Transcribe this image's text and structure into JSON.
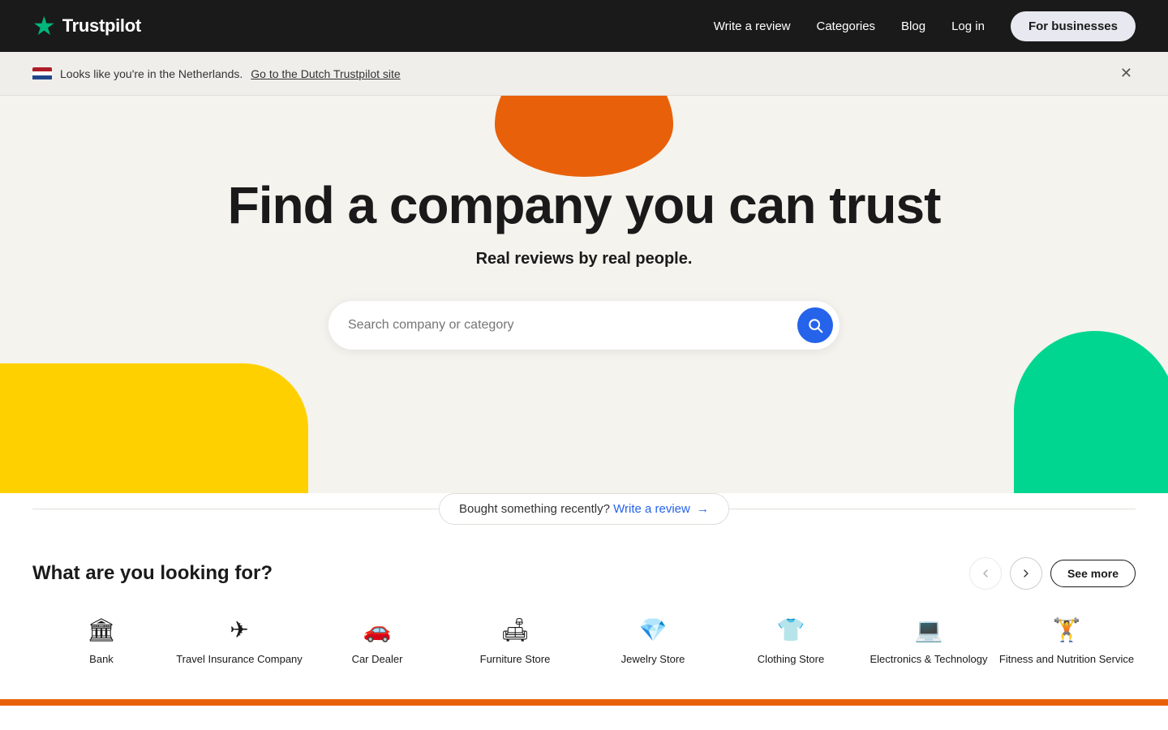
{
  "navbar": {
    "logo_text": "Trustpilot",
    "links": [
      {
        "id": "write-review",
        "label": "Write a review"
      },
      {
        "id": "categories",
        "label": "Categories"
      },
      {
        "id": "blog",
        "label": "Blog"
      },
      {
        "id": "login",
        "label": "Log in"
      }
    ],
    "for_businesses_label": "For businesses"
  },
  "banner": {
    "message": "Looks like you're in the Netherlands.",
    "link_text": "Go to the Dutch Trustpilot site",
    "link_href": "#"
  },
  "hero": {
    "title": "Find a company you can trust",
    "subtitle": "Real reviews by real people.",
    "search_placeholder": "Search company or category"
  },
  "cta": {
    "text": "Bought something recently?",
    "link_text": "Write a review",
    "arrow": "→"
  },
  "categories": {
    "section_title": "What are you looking for?",
    "see_more_label": "See more",
    "items": [
      {
        "id": "bank",
        "label": "Bank",
        "icon": "🏛"
      },
      {
        "id": "travel-insurance",
        "label": "Travel Insurance Company",
        "icon": "✈"
      },
      {
        "id": "car-dealer",
        "label": "Car Dealer",
        "icon": "🚗"
      },
      {
        "id": "furniture-store",
        "label": "Furniture Store",
        "icon": "🛋"
      },
      {
        "id": "jewelry-store",
        "label": "Jewelry Store",
        "icon": "💎"
      },
      {
        "id": "clothing-store",
        "label": "Clothing Store",
        "icon": "👕"
      },
      {
        "id": "electronics",
        "label": "Electronics & Technology",
        "icon": "💻"
      },
      {
        "id": "fitness",
        "label": "Fitness and Nutrition Service",
        "icon": "🏋"
      }
    ]
  },
  "colors": {
    "brand_green": "#00b67a",
    "nav_bg": "#1a1a1a",
    "hero_bg": "#f5f3ee",
    "orange": "#e8610a",
    "yellow": "#ffd000",
    "green_deco": "#00d68f",
    "blue_btn": "#2563eb"
  }
}
